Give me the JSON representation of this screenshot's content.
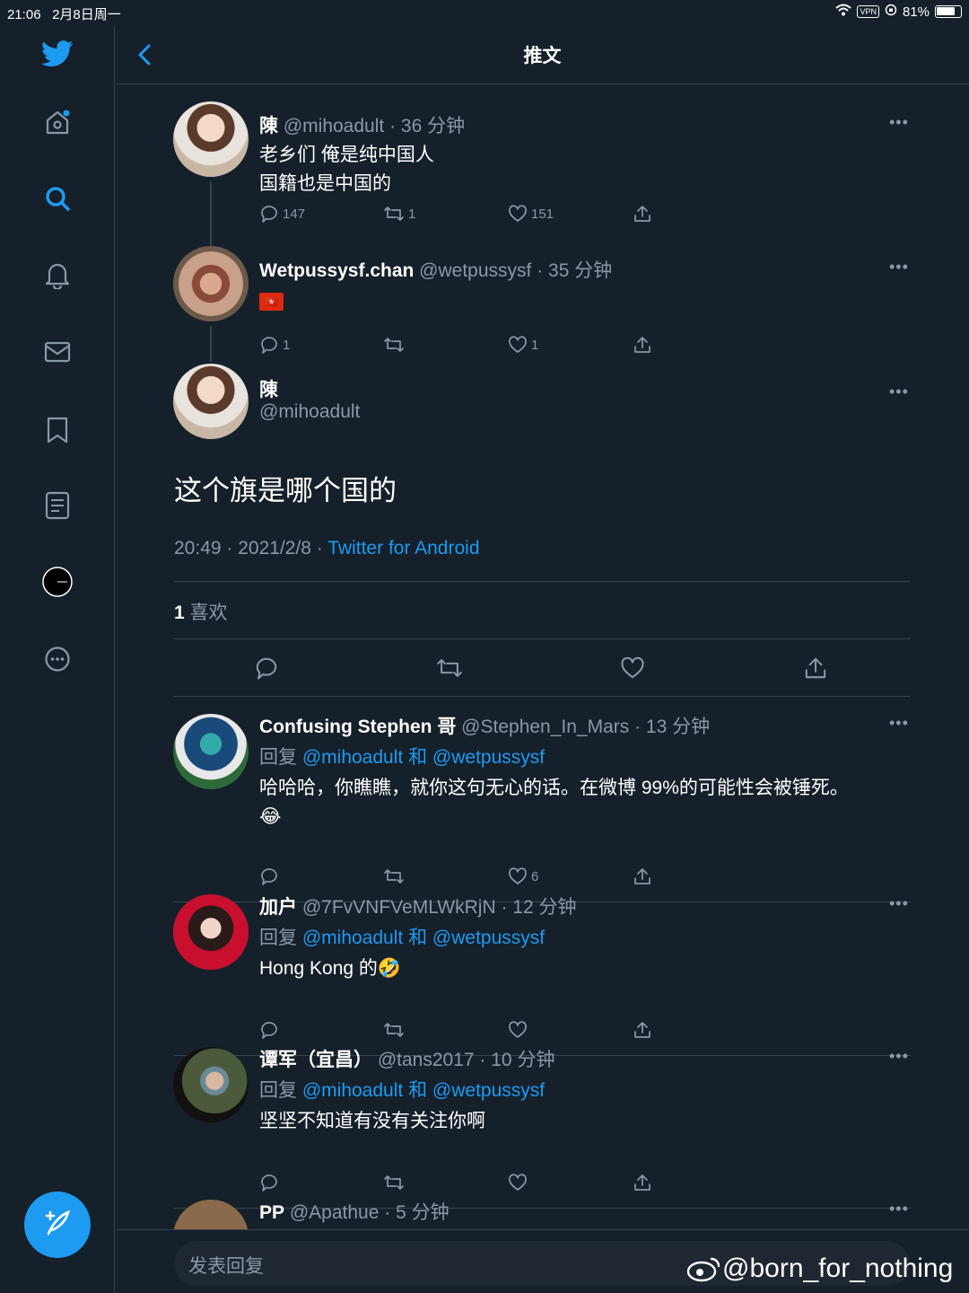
{
  "status": {
    "time": "21:06",
    "date": "2月8日周一",
    "vpn": "VPN",
    "battery": "81%",
    "battery_level": 0.81
  },
  "header": {
    "title": "推文"
  },
  "tweets": [
    {
      "name": "陳",
      "handle": "@mihoadult",
      "time": "· 36 分钟",
      "lines": [
        "老乡们 俺是纯中国人",
        "国籍也是中国的"
      ],
      "reply": "147",
      "retweet": "1",
      "like": "151"
    },
    {
      "name": "Wetpussysf.chan",
      "handle": "@wetpussysf",
      "time": "· 35 分钟",
      "flag": "🇭🇰",
      "reply": "1",
      "retweet": "",
      "like": "1"
    }
  ],
  "main_tweet": {
    "name": "陳",
    "handle": "@mihoadult",
    "text": "这个旗是哪个国的",
    "time": "20:49 · 2021/2/8 ·",
    "source": "Twitter for Android",
    "likes_count": "1",
    "likes_label": "喜欢"
  },
  "replies": [
    {
      "name": "Confusing Stephen 哥",
      "handle": "@Stephen_In_Mars",
      "time": "· 13 分钟",
      "reply_prefix": "回复",
      "mention1": "@mihoadult",
      "and": "和",
      "mention2": "@wetpussysf",
      "text": "哈哈哈，你瞧瞧，就你这句无心的话。在微博 99%的可能性会被锤死。",
      "emoji": "😂",
      "like": "6"
    },
    {
      "name": "加户",
      "handle": "@7FvVNFVeMLWkRjN",
      "time": "· 12 分钟",
      "reply_prefix": "回复",
      "mention1": "@mihoadult",
      "and": "和",
      "mention2": "@wetpussysf",
      "text": "Hong Kong 的",
      "emoji": "🤣",
      "like": ""
    },
    {
      "name": "谭军（宜昌）",
      "handle": "@tans2017",
      "time": "· 10 分钟",
      "reply_prefix": "回复",
      "mention1": "@mihoadult",
      "and": "和",
      "mention2": "@wetpussysf",
      "text": "坚坚不知道有没有关注你啊",
      "emoji": "",
      "like": ""
    },
    {
      "name": "PP",
      "handle": "@Apathue",
      "time": "· 5 分钟"
    }
  ],
  "reply_bar": {
    "placeholder": "发表回复"
  },
  "watermark": "@born_for_nothing",
  "colors": {
    "background": "#15202b",
    "accent": "#1d9bf0",
    "secondary_text": "#8b98a5",
    "border": "#38444d"
  }
}
